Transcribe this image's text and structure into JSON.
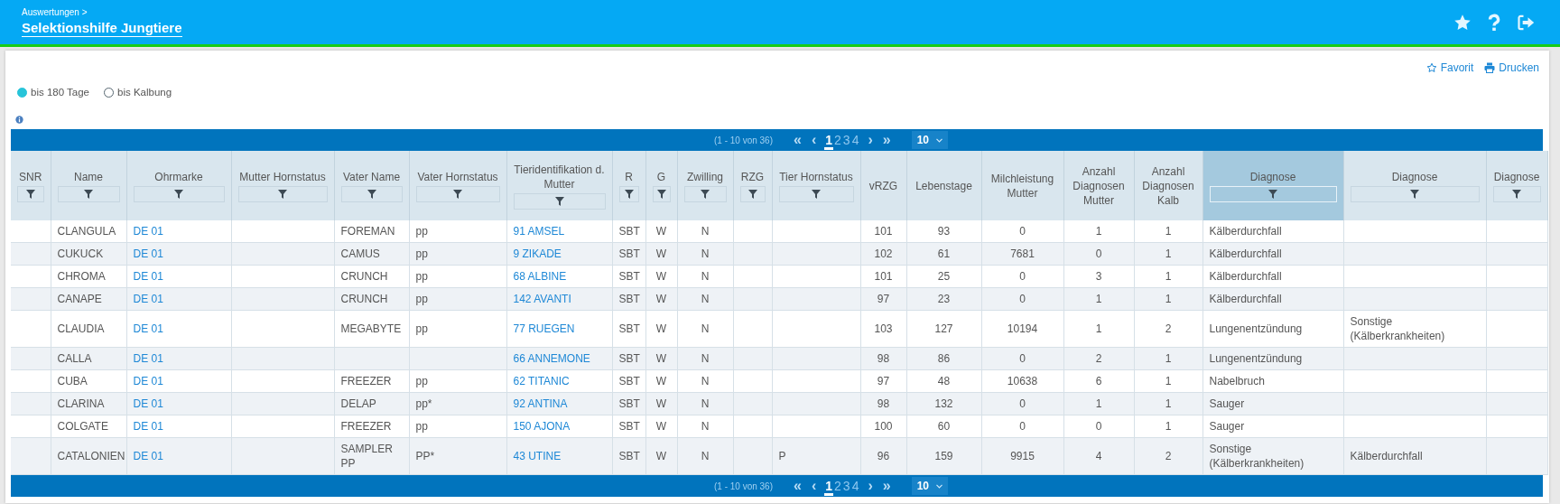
{
  "header": {
    "breadcrumb": "Auswertungen >",
    "title": "Selektionshilfe Jungtiere"
  },
  "actions": [
    "Favorit",
    "Drucken"
  ],
  "period_options": [
    {
      "label": "bis 180 Tage",
      "selected": true
    },
    {
      "label": "bis Kalbung",
      "selected": false
    }
  ],
  "pager_top": {
    "range": "(1 - 10 von 36)",
    "first": "«",
    "prev": "‹",
    "pages": [
      {
        "label": "1",
        "selected": true
      },
      {
        "label": "2",
        "selected": false
      },
      {
        "label": "3",
        "selected": false
      },
      {
        "label": "4",
        "selected": false
      }
    ],
    "next": "›",
    "last": "»",
    "page_size": "10"
  },
  "table": {
    "columns": [
      {
        "label": "SNR",
        "kind": "text",
        "filter": true,
        "selected": false
      },
      {
        "label": "Name",
        "kind": "text",
        "filter": true,
        "selected": false
      },
      {
        "label": "Ohrmarke",
        "kind": "link",
        "filter": true,
        "selected": false
      },
      {
        "label": "Mutter Hornstatus",
        "kind": "text",
        "filter": true,
        "selected": false
      },
      {
        "label": "Vater Name",
        "kind": "text",
        "filter": true,
        "selected": false
      },
      {
        "label": "Vater Hornstatus",
        "kind": "text",
        "filter": true,
        "selected": false
      },
      {
        "label": "Tieridentifikation d. Mutter",
        "kind": "link",
        "filter": true,
        "selected": false
      },
      {
        "label": "R",
        "kind": "number",
        "filter": true,
        "selected": false
      },
      {
        "label": "G",
        "kind": "number",
        "filter": true,
        "selected": false
      },
      {
        "label": "Zwilling",
        "kind": "number",
        "filter": true,
        "selected": false
      },
      {
        "label": "RZG",
        "kind": "number",
        "filter": true,
        "selected": false
      },
      {
        "label": "Tier Hornstatus",
        "kind": "text",
        "filter": true,
        "selected": false
      },
      {
        "label": "vRZG",
        "kind": "number",
        "filter": false,
        "selected": false
      },
      {
        "label": "Lebenstage",
        "kind": "number",
        "filter": false,
        "selected": false
      },
      {
        "label": "Milchleistung Mutter",
        "kind": "number",
        "filter": false,
        "selected": false
      },
      {
        "label": "Anzahl Diagnosen Mutter",
        "kind": "number",
        "filter": false,
        "selected": false
      },
      {
        "label": "Anzahl Diagnosen Kalb",
        "kind": "number",
        "filter": false,
        "selected": false
      },
      {
        "label": "Diagnose",
        "kind": "text",
        "filter": true,
        "selected": true
      },
      {
        "label": "Diagnose",
        "kind": "text",
        "filter": true,
        "selected": false
      },
      {
        "label": "Diagnose",
        "kind": "text",
        "filter": true,
        "selected": false
      }
    ],
    "rows": [
      [
        null,
        "CLANGULA",
        "DE 01",
        null,
        "FOREMAN",
        "pp",
        "91 AMSEL",
        "SBT",
        "W",
        "N",
        null,
        null,
        "101",
        "93",
        "0",
        "1",
        "1",
        "Kälberdurchfall",
        null,
        null
      ],
      [
        null,
        "CUKUCK",
        "DE 01",
        null,
        "CAMUS",
        "pp",
        "9 ZIKADE",
        "SBT",
        "W",
        "N",
        null,
        null,
        "102",
        "61",
        "7681",
        "0",
        "1",
        "Kälberdurchfall",
        null,
        null
      ],
      [
        null,
        "CHROMA",
        "DE 01",
        null,
        "CRUNCH",
        "pp",
        "68 ALBINE",
        "SBT",
        "W",
        "N",
        null,
        null,
        "101",
        "25",
        "0",
        "3",
        "1",
        "Kälberdurchfall",
        null,
        null
      ],
      [
        null,
        "CANAPE",
        "DE 01",
        null,
        "CRUNCH",
        "pp",
        "142 AVANTI",
        "SBT",
        "W",
        "N",
        null,
        null,
        "97",
        "23",
        "0",
        "1",
        "1",
        "Kälberdurchfall",
        null,
        null
      ],
      [
        null,
        "CLAUDIA",
        "DE 01",
        null,
        "MEGABYTE",
        "pp",
        "77 RUEGEN",
        "SBT",
        "W",
        "N",
        null,
        null,
        "103",
        "127",
        "10194",
        "1",
        "2",
        "Lungenentzündung",
        "Sonstige (Kälberkrankheiten)",
        null
      ],
      [
        null,
        "CALLA",
        "DE 01",
        null,
        null,
        null,
        "66 ANNEMONE",
        "SBT",
        "W",
        "N",
        null,
        null,
        "98",
        "86",
        "0",
        "2",
        "1",
        "Lungenentzündung",
        null,
        null
      ],
      [
        null,
        "CUBA",
        "DE 01",
        null,
        "FREEZER",
        "pp",
        "62 TITANIC",
        "SBT",
        "W",
        "N",
        null,
        null,
        "97",
        "48",
        "10638",
        "6",
        "1",
        "Nabelbruch",
        null,
        null
      ],
      [
        null,
        "CLARINA",
        "DE 01",
        null,
        "DELAP",
        "pp*",
        "92 ANTINA",
        "SBT",
        "W",
        "N",
        null,
        null,
        "98",
        "132",
        "0",
        "1",
        "1",
        "Sauger",
        null,
        null
      ],
      [
        null,
        "COLGATE",
        "DE 01",
        null,
        "FREEZER",
        "pp",
        "150 AJONA",
        "SBT",
        "W",
        "N",
        null,
        null,
        "100",
        "60",
        "0",
        "0",
        "1",
        "Sauger",
        null,
        null
      ],
      [
        null,
        "CATALONIEN",
        "DE 01",
        null,
        "SAMPLER PP",
        "PP*",
        "43 UTINE",
        "SBT",
        "W",
        "N",
        null,
        "P",
        "96",
        "159",
        "9915",
        "4",
        "2",
        "Sonstige (Kälberkrankheiten)",
        "Kälberdurchfall",
        null
      ]
    ]
  },
  "pager_bottom": {
    "range": "(1 - 10 von 36)",
    "first": "«",
    "prev": "‹",
    "pages": [
      {
        "label": "1",
        "selected": true
      },
      {
        "label": "2",
        "selected": false
      },
      {
        "label": "3",
        "selected": false
      },
      {
        "label": "4",
        "selected": false
      }
    ],
    "next": "›",
    "last": "»",
    "page_size": "10"
  }
}
